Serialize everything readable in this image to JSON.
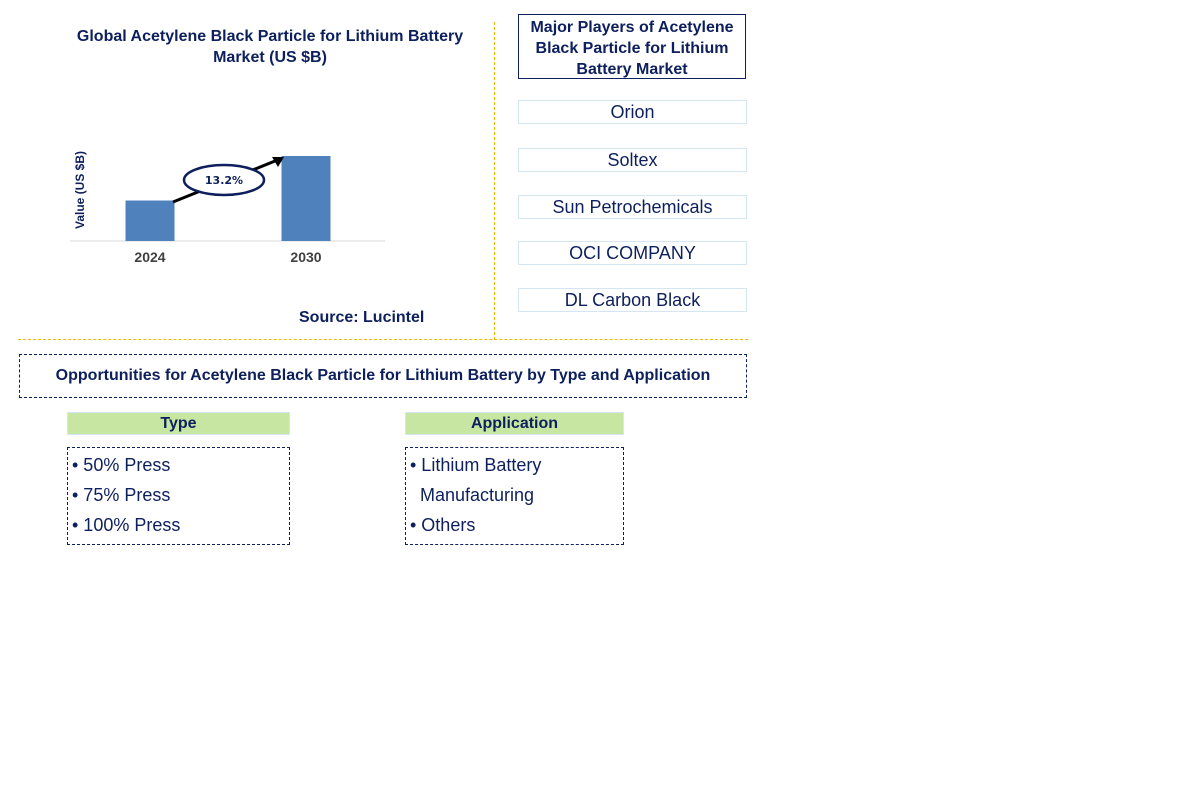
{
  "chart_data": {
    "type": "bar",
    "title": "Global Acetylene Black Particle for Lithium Battery Market (US $B)",
    "xlabel": "",
    "ylabel": "Value (US $B)",
    "categories": [
      "2024",
      "2030"
    ],
    "values": [
      1.0,
      2.1
    ],
    "annotation": {
      "label": "13.2%",
      "meaning": "CAGR 2024-2030"
    },
    "bar_color": "#4f81bd",
    "grid": false,
    "source": "Source: Lucintel"
  },
  "players": {
    "header": "Major Players of Acetylene Black Particle for Lithium Battery Market",
    "items": [
      "Orion",
      "Soltex",
      "Sun Petrochemicals",
      "OCI COMPANY",
      "DL Carbon Black"
    ]
  },
  "opportunities": {
    "title": "Opportunities for Acetylene Black Particle for Lithium Battery by Type and Application",
    "type": {
      "header": "Type",
      "items": [
        "• 50% Press",
        "• 75% Press",
        "• 100% Press"
      ]
    },
    "application": {
      "header": "Application",
      "items": [
        "• Lithium Battery",
        "Manufacturing",
        "• Others"
      ]
    }
  },
  "colors": {
    "text": "#0d1f5c",
    "divider": "#f2b705",
    "category_header_bg": "#c6e6a2"
  }
}
